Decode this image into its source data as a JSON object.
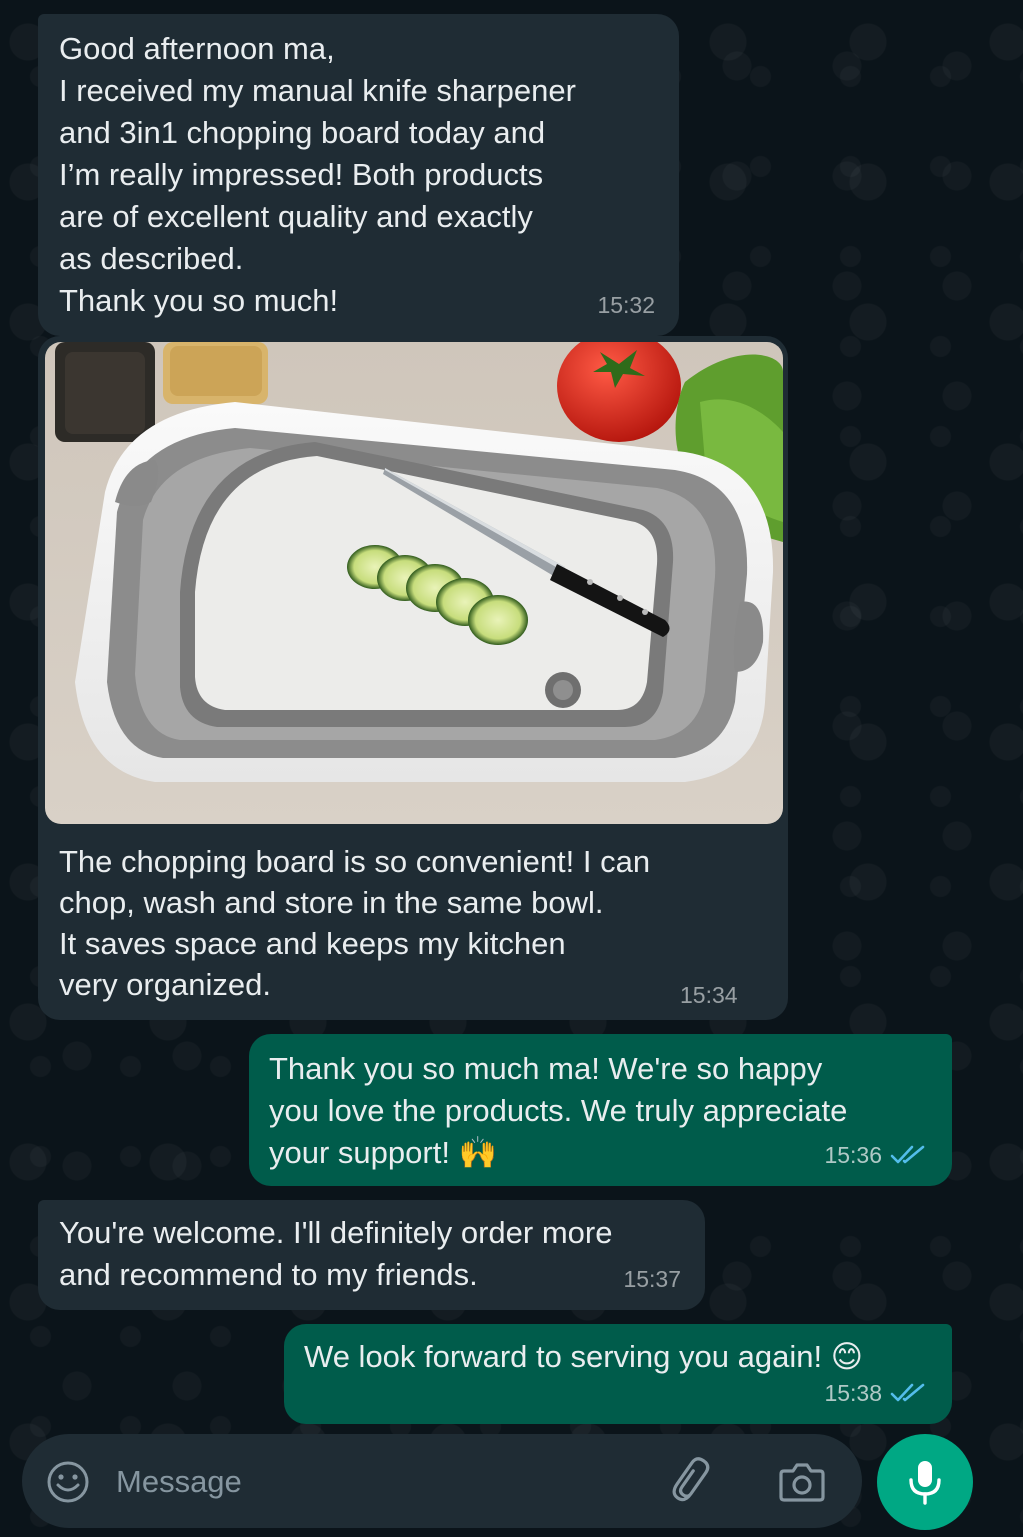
{
  "messages": [
    {
      "direction": "incoming",
      "text": "Good afternoon ma,\nI received my manual knife sharpener\nand 3in1 chopping board today and\nI’m really impressed! Both products\nare of excellent quality and exactly\nas described.\nThank you so much!",
      "time": "15:32"
    },
    {
      "direction": "incoming",
      "type": "image",
      "image_desc_icon": "chopping-board-photo",
      "text": "The chopping board is so convenient! I can\nchop, wash and store in the same bowl.\nIt saves space and keeps my kitchen\nvery organized.",
      "time": "15:34"
    },
    {
      "direction": "outgoing",
      "text": "Thank you so much ma! We're so happy\nyou love the products. We truly appreciate\nyour support! 🙌",
      "time": "15:36",
      "status": "read"
    },
    {
      "direction": "incoming",
      "text": "You're welcome. I'll definitely order more\nand recommend to my friends.",
      "time": "15:37"
    },
    {
      "direction": "outgoing",
      "text": "We look forward to serving you again! 😊",
      "time": "15:38",
      "status": "read"
    }
  ],
  "composer": {
    "placeholder": "Message",
    "icons": [
      "emoji-icon",
      "attach-icon",
      "camera-icon",
      "mic-icon"
    ]
  },
  "colors": {
    "background": "#0b141a",
    "incoming": "#1f2c34",
    "outgoing": "#005c4b",
    "accent": "#00a884",
    "read_ticks": "#53bdeb"
  }
}
